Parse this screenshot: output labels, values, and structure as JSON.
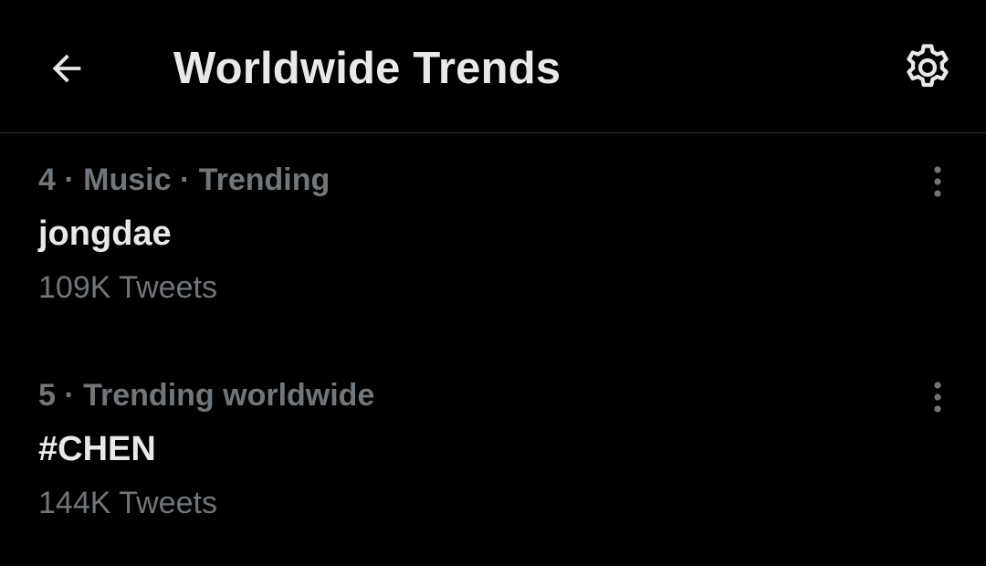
{
  "header": {
    "title": "Worldwide Trends",
    "back_icon": "arrow-left-icon",
    "settings_icon": "gear-icon"
  },
  "trends": [
    {
      "meta": "4 · Music · Trending",
      "name": "jongdae",
      "count": "109K Tweets"
    },
    {
      "meta": "5 · Trending worldwide",
      "name": "#CHEN",
      "count": "144K Tweets"
    }
  ],
  "colors": {
    "background": "#000000",
    "primary_text": "#e7e9ea",
    "secondary_text": "#71767b",
    "divider": "#2f3336"
  }
}
